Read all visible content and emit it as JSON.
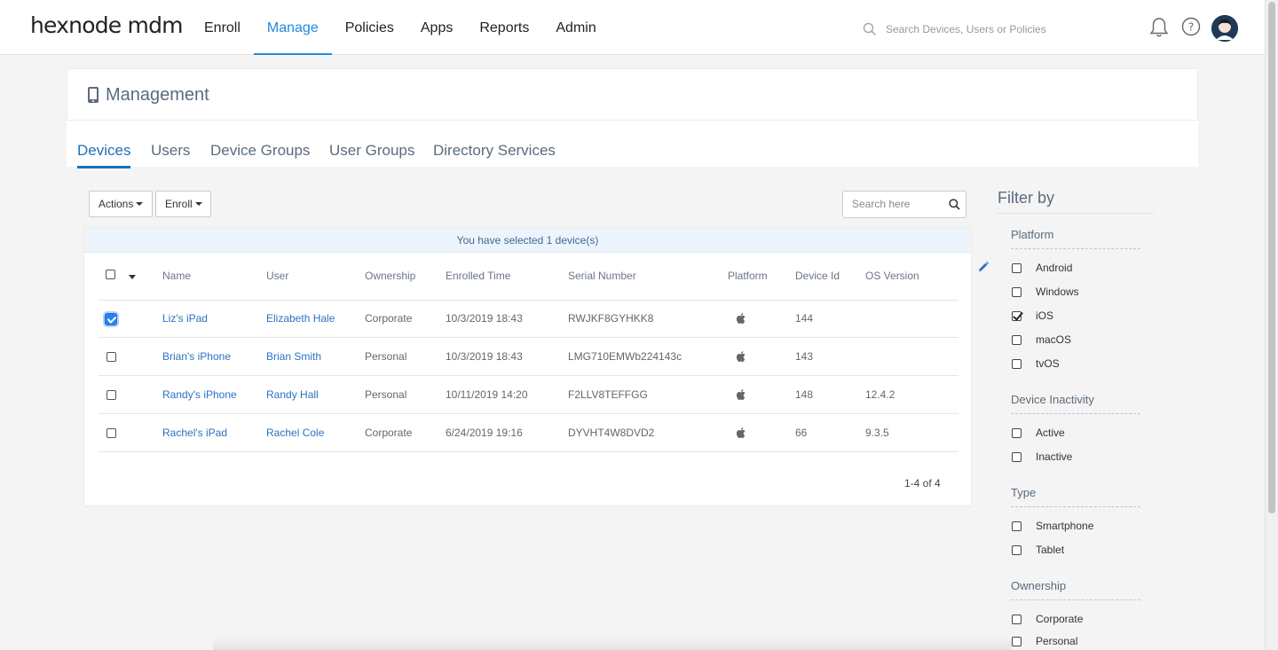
{
  "brand": {
    "logo": "hexnode mdm"
  },
  "nav": {
    "items": [
      {
        "label": "Enroll"
      },
      {
        "label": "Manage"
      },
      {
        "label": "Policies"
      },
      {
        "label": "Apps"
      },
      {
        "label": "Reports"
      },
      {
        "label": "Admin"
      }
    ],
    "active": "Manage"
  },
  "global_search": {
    "placeholder": "Search Devices, Users or Policies"
  },
  "page": {
    "title": "Management"
  },
  "tabs": [
    {
      "label": "Devices"
    },
    {
      "label": "Users"
    },
    {
      "label": "Device Groups"
    },
    {
      "label": "User Groups"
    },
    {
      "label": "Directory Services"
    }
  ],
  "toolbar": {
    "actions_label": "Actions",
    "enroll_label": "Enroll",
    "search_placeholder": "Search here"
  },
  "selection_banner": "You have selected 1 device(s)",
  "table": {
    "columns": [
      "Name",
      "User",
      "Ownership",
      "Enrolled Time",
      "Serial Number",
      "Platform",
      "Device Id",
      "OS Version"
    ],
    "rows": [
      {
        "checked": true,
        "name": "Liz's iPad",
        "user": "Elizabeth Hale",
        "ownership": "Corporate",
        "enrolled": "10/3/2019 18:43",
        "serial": "RWJKF8GYHKK8",
        "platform_icon": "apple-icon",
        "device_id": "144",
        "os": ""
      },
      {
        "checked": false,
        "name": "Brian's iPhone",
        "user": "Brian Smith",
        "ownership": "Personal",
        "enrolled": "10/3/2019 18:43",
        "serial": "LMG710EMWb224143c",
        "platform_icon": "apple-icon",
        "device_id": "143",
        "os": ""
      },
      {
        "checked": false,
        "name": "Randy's iPhone",
        "user": "Randy Hall",
        "ownership": "Personal",
        "enrolled": "10/11/2019 14:20",
        "serial": "F2LLV8TEFFGG",
        "platform_icon": "apple-icon",
        "device_id": "148",
        "os": "12.4.2"
      },
      {
        "checked": false,
        "name": "Rachel's iPad",
        "user": "Rachel Cole",
        "ownership": "Corporate",
        "enrolled": "6/24/2019 19:16",
        "serial": "DYVHT4W8DVD2",
        "platform_icon": "apple-icon",
        "device_id": "66",
        "os": "9.3.5"
      }
    ],
    "pagination": "1-4 of 4"
  },
  "filters": {
    "title": "Filter by",
    "sections": [
      {
        "title": "Platform",
        "options": [
          {
            "label": "Android",
            "checked": false
          },
          {
            "label": "Windows",
            "checked": false
          },
          {
            "label": "iOS",
            "checked": true
          },
          {
            "label": "macOS",
            "checked": false
          },
          {
            "label": "tvOS",
            "checked": false
          }
        ]
      },
      {
        "title": "Device Inactivity",
        "options": [
          {
            "label": "Active",
            "checked": false
          },
          {
            "label": "Inactive",
            "checked": false
          }
        ]
      },
      {
        "title": "Type",
        "options": [
          {
            "label": "Smartphone",
            "checked": false
          },
          {
            "label": "Tablet",
            "checked": false
          }
        ]
      },
      {
        "title": "Ownership",
        "options": [
          {
            "label": "Corporate",
            "checked": false
          },
          {
            "label": "Personal",
            "checked": false
          }
        ]
      }
    ]
  },
  "colors": {
    "accent": "#1f8ae0",
    "link": "#2a73c0",
    "heading": "#5b6b7d",
    "banner_bg": "#eef4fb"
  }
}
